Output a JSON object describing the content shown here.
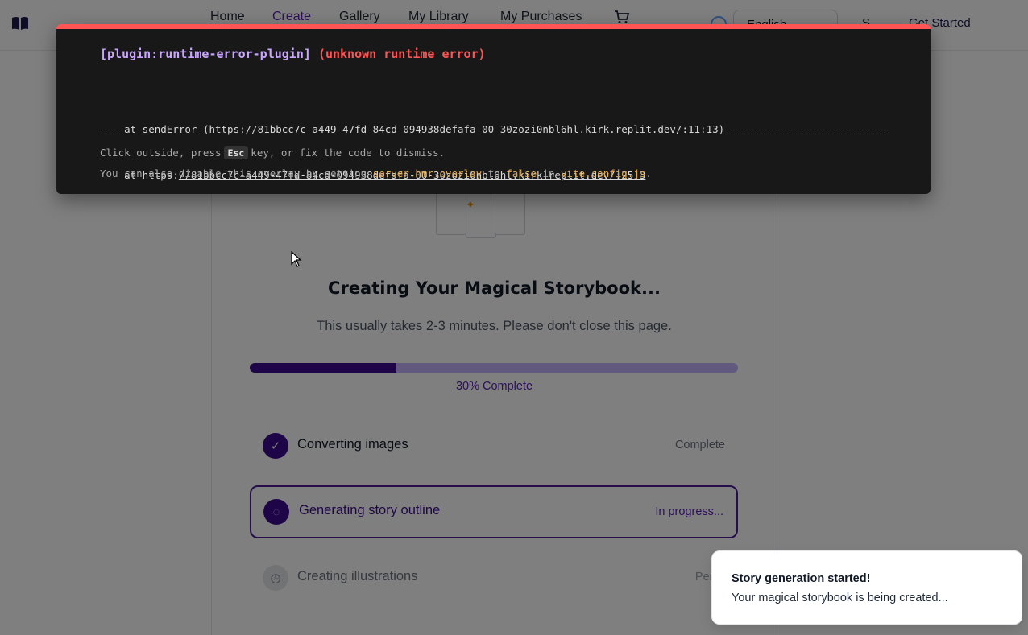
{
  "nav": {
    "logo_icon": "open-book-icon",
    "links": [
      "Home",
      "Create",
      "Gallery",
      "My Library",
      "My Purchases"
    ],
    "active_link": "Create",
    "cart_icon": "cart-icon",
    "language": "English",
    "signin_label": "S",
    "cta_label": "Get Started"
  },
  "progress": {
    "title": "Creating Your Magical Storybook...",
    "subtitle": "This usually takes 2-3 minutes. Please don't close this page.",
    "percent": 30,
    "percent_label": "30% Complete",
    "fill_color": "#3b0a8f",
    "steps": [
      {
        "label": "Converting images",
        "status": "Complete",
        "state": "done"
      },
      {
        "label": "Generating story outline",
        "status": "In progress...",
        "state": "current"
      },
      {
        "label": "Creating illustrations",
        "status": "Pendi",
        "state": "pending"
      }
    ]
  },
  "error_overlay": {
    "plugin": "[plugin:runtime-error-plugin]",
    "message": "(unknown runtime error)",
    "stack": [
      {
        "prefix": "at sendError (https:",
        "link": "//81bbcc7c-a449-47fd-84cd-094938defafa-00-30zozi0nbl6hl.kirk.replit.dev/:11:13",
        "suffix": ")"
      },
      {
        "prefix": "at https:",
        "link": "//81bbcc7c-a449-47fd-84cd-094938defafa-00-30zozi0nbl6hl.kirk.replit.dev/:25:3",
        "suffix": ""
      }
    ],
    "tip1_a": "Click outside, press",
    "tip1_key": "Esc",
    "tip1_b": "key, or fix the code to dismiss.",
    "tip2_a": "You can also disable this overlay by setting",
    "tip2_setting": "server.hmr.overlay",
    "tip2_b": "to",
    "tip2_value": "false",
    "tip2_c": "in",
    "tip2_file": "vite.config.js",
    "tip2_d": "."
  },
  "toast": {
    "title": "Story generation started!",
    "description": "Your magical storybook is being created..."
  }
}
